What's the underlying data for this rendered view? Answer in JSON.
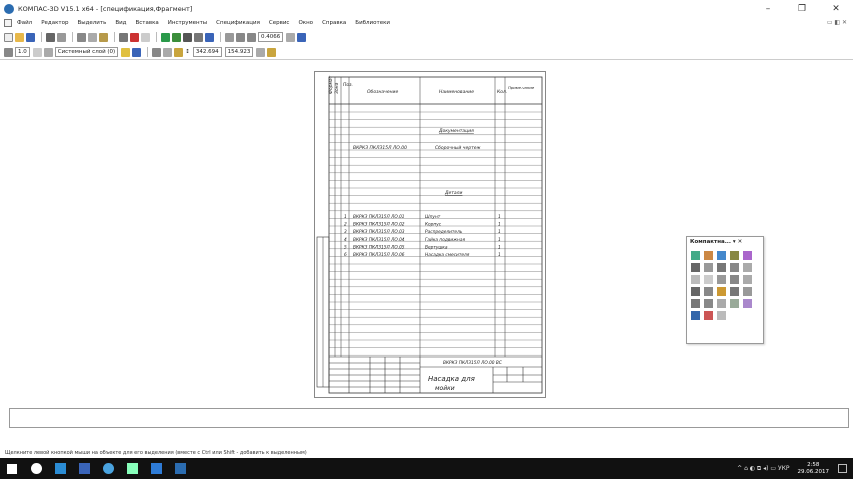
{
  "window": {
    "title": "КОМПАС-3D V15.1 x64 - [спецификация,Фрагмент]",
    "minimize": "–",
    "maximize": "❐",
    "close": "✕"
  },
  "menu": {
    "items": [
      "Файл",
      "Редактор",
      "Выделить",
      "Вид",
      "Вставка",
      "Инструменты",
      "Спецификация",
      "Сервис",
      "Окно",
      "Справка",
      "Библиотеки"
    ],
    "right_icons": "▭ ◧ ✕"
  },
  "toolbar": {
    "zoom_value": "0.4066",
    "line_width": "1.0",
    "layer_label": "Системный слой (0)",
    "coord_x": "342.694",
    "coord_y": "154.923"
  },
  "spec": {
    "headers": [
      "Формат",
      "Зона",
      "Поз.",
      "Обозначение",
      "Наименование",
      "Кол.",
      "Приме-чание"
    ],
    "section_documentation": "Документация",
    "doc_row": {
      "designation": "ВКРКЗ ПКЛЗ15Л ЛО.00",
      "name": "Сборочный чертеж"
    },
    "section_details": "Детали",
    "rows": [
      {
        "pos": "1",
        "designation": "ВКРКЗ ПКЛЗ15Л ЛО.01",
        "name": "Шпунт",
        "qty": "1"
      },
      {
        "pos": "2",
        "designation": "ВКРКЗ ПКЛЗ15Л ЛО.02",
        "name": "Корпус",
        "qty": "1"
      },
      {
        "pos": "3",
        "designation": "ВКРКЗ ПКЛЗ15Л ЛО.03",
        "name": "Распределитель",
        "qty": "1"
      },
      {
        "pos": "4",
        "designation": "ВКРКЗ ПКЛЗ15Л ЛО.04",
        "name": "Гайка подвижная",
        "qty": "1"
      },
      {
        "pos": "5",
        "designation": "ВКРКЗ ПКЛЗ15Л ЛО.05",
        "name": "Вертушка",
        "qty": "1"
      },
      {
        "pos": "6",
        "designation": "ВКРКЗ ПКЛЗ15Л ЛО.06",
        "name": "Насадка смесителя",
        "qty": "1"
      }
    ],
    "stamp_code": "ВКРКЗ ПКЛЗ15Л ЛО.00 ВС",
    "stamp_title_line1": "Насадка для",
    "stamp_title_line2": "мойки"
  },
  "status": {
    "hint": "Щелкните левой кнопкой мыши на объекте для его выделения (вместе с Ctrl или Shift - добавить к выделенным)"
  },
  "panel": {
    "title": "Компактна... ▾ ✕"
  },
  "taskbar": {
    "tray_text": "^ ⌂ ◐ ⧉ ◂) ▭ УКР",
    "time": "2:58",
    "date": "29.06.2017"
  }
}
